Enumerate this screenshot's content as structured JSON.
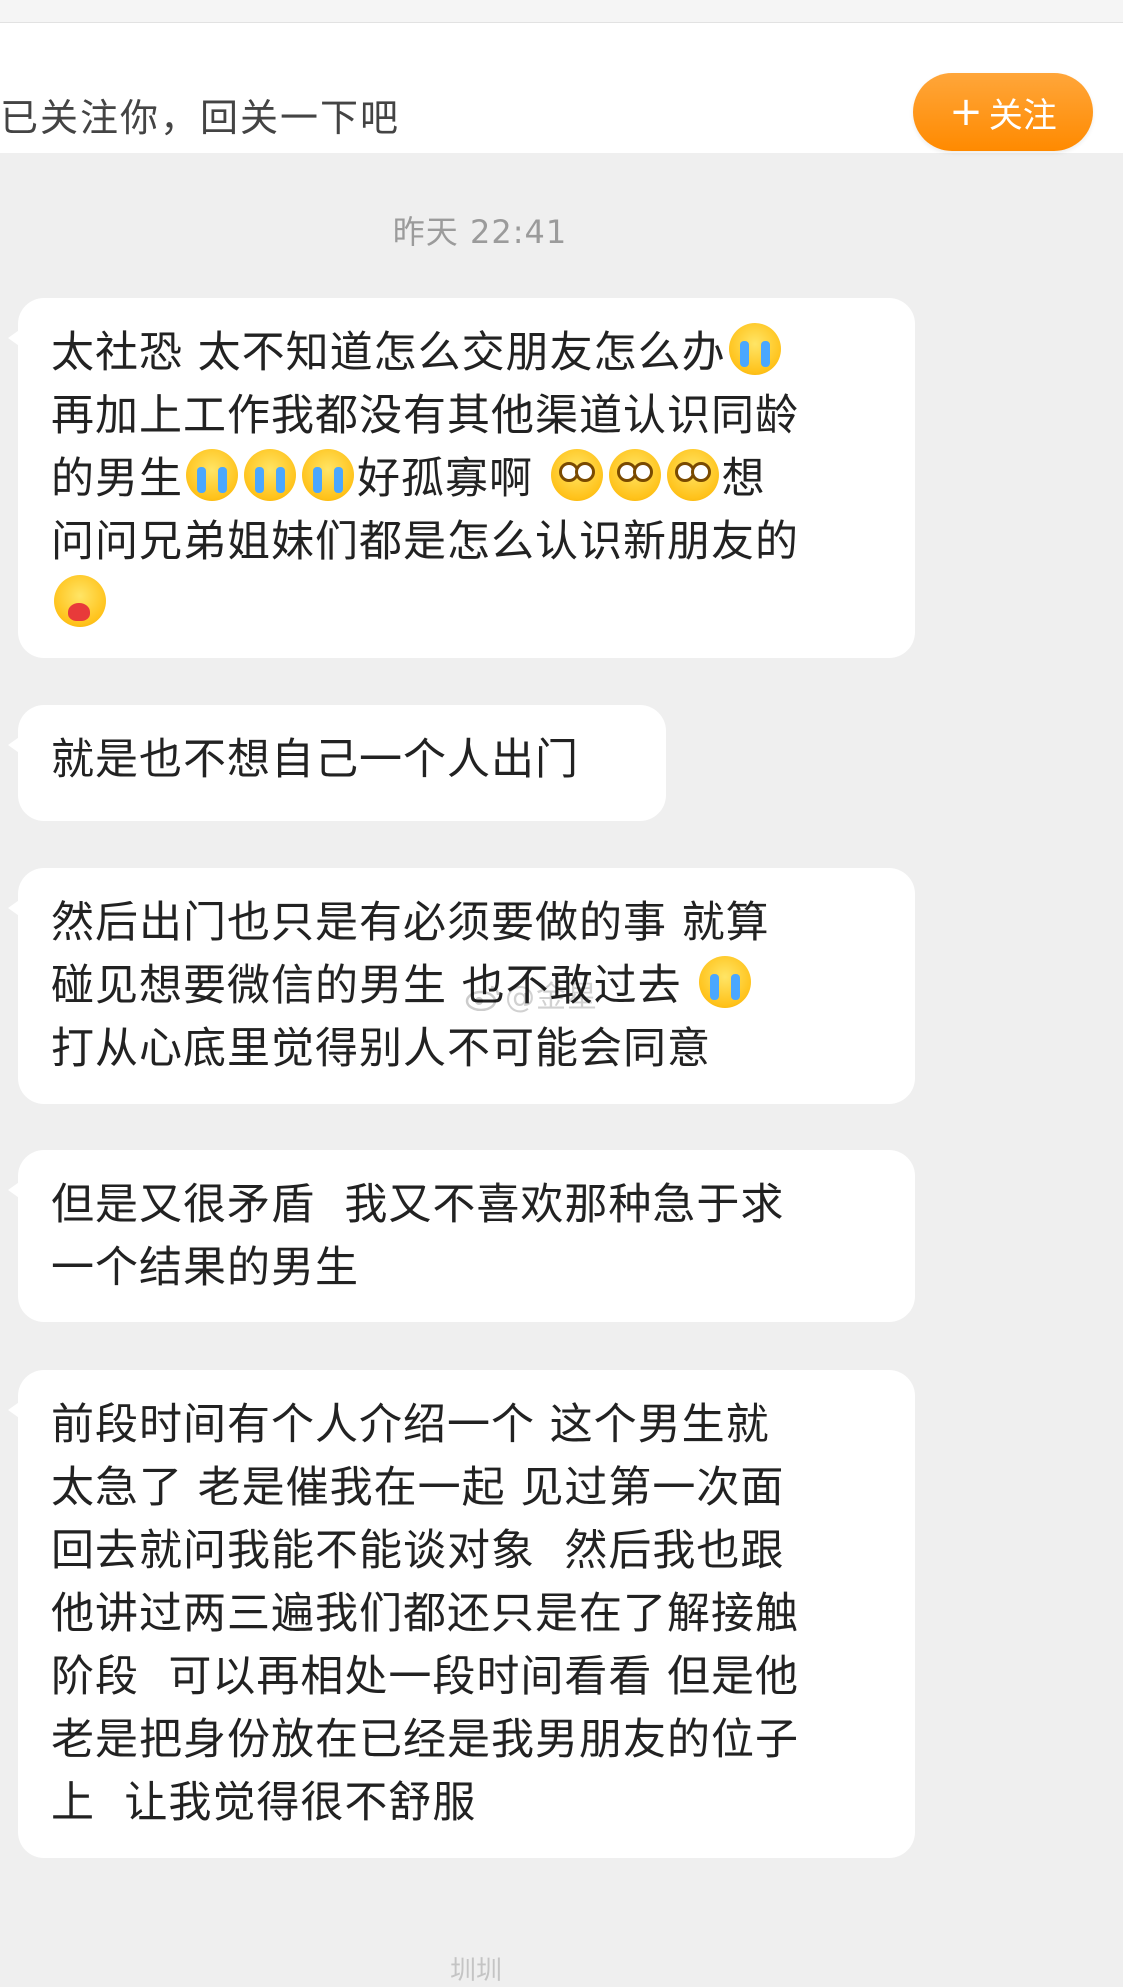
{
  "follow_bar": {
    "text": "已关注你，回关一下吧",
    "button_label": "关注",
    "button_color": "#ff9a1f"
  },
  "timestamp": "昨天 22:41",
  "messages": [
    {
      "line1": "太社恐 太不知道怎么交朋友怎么办",
      "line2": "再加上工作我都没有其他渠道认识同龄",
      "line3a": "的男生",
      "line3b": "好孤寡啊",
      "line3c": "想",
      "line4": "问问兄弟姐妹们都是怎么认识新朋友的",
      "emojis": [
        "crying-emoji",
        "crying-emoji",
        "crying-emoji",
        "crying-emoji",
        "dizzy-emoji",
        "dizzy-emoji",
        "dizzy-emoji",
        "hug-emoji"
      ]
    },
    {
      "line1": "就是也不想自己一个人出门"
    },
    {
      "line1": "然后出门也只是有必须要做的事 就算",
      "line2": "碰见想要微信的男生 也不敢过去",
      "line3": "打从心底里觉得别人不可能会同意"
    },
    {
      "line1": "但是又很矛盾  我又不喜欢那种急于求",
      "line2": "一个结果的男生"
    },
    {
      "line1": "前段时间有个人介绍一个 这个男生就",
      "line2": "太急了 老是催我在一起 见过第一次面",
      "line3": "回去就问我能不能谈对象  然后我也跟",
      "line4": "他讲过两三遍我们都还只是在了解接触",
      "line5": "阶段  可以再相处一段时间看看 但是他",
      "line6": "老是把身份放在已经是我男朋友的位子",
      "line7": "上  让我觉得很不舒服"
    }
  ],
  "watermark": "@金星",
  "bottom_mark": "圳圳"
}
